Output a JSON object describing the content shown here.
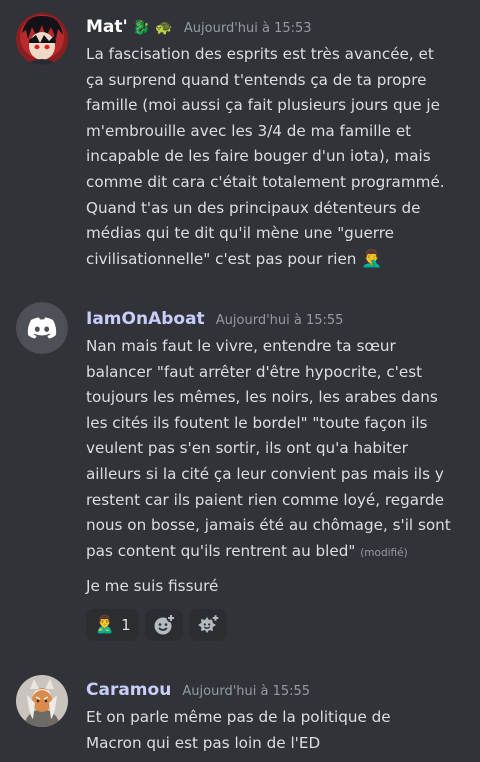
{
  "messages": [
    {
      "author": "Mat'",
      "author_color": "#ffffff",
      "author_emojis": [
        "🐉",
        "🐢"
      ],
      "timestamp": "Aujourd'hui à 15:53",
      "avatar": "anime-character-avatar",
      "lines": [
        "La fascisation des esprits est très avancée, et",
        "ça surprend quand t'entends ça de ta propre",
        "famille (moi aussi ça fait plusieurs jours que je",
        "m'embrouille avec les 3/4 de ma famille et",
        "incapable de les faire bouger d'un iota), mais",
        "comme dit cara c'était totalement programmé.",
        "Quand t'as un des principaux détenteurs de",
        "médias qui te dit qu'il mène une \"guerre",
        "civilisationnelle\" c'est pas pour rien"
      ],
      "trailing_emoji": "🤦‍♂️"
    },
    {
      "author": "IamOnAboat",
      "author_color": "#c9cdfb",
      "timestamp": "Aujourd'hui à 15:55",
      "avatar": "discord-logo-avatar",
      "lines": [
        "Nan mais faut le vivre, entendre ta sœur",
        "balancer \"faut arrêter d'être hypocrite, c'est",
        "toujours les mêmes, les noirs, les arabes dans",
        "les cités ils foutent le bordel\" \"toute façon ils",
        "veulent pas s'en sortir, ils ont qu'a habiter",
        "ailleurs si la cité ça leur convient pas mais ils y",
        "restent car ils paient rien comme loyé, regarde",
        "nous on bosse, jamais été au chômage, s'il sont",
        "pas content qu'ils rentrent au bled\""
      ],
      "edited": "(modifié)",
      "followup": "Je me suis fissuré",
      "reactions": [
        {
          "emoji": "🙎‍♂️",
          "count": "1"
        }
      ],
      "add_reaction_icons": [
        "add-reaction-icon",
        "add-super-reaction-icon"
      ]
    },
    {
      "author": "Caramou",
      "author_color": "#c9cdfb",
      "timestamp": "Aujourd'hui à 15:55",
      "avatar": "warrior-character-avatar",
      "lines": [
        "Et on parle même pas de la politique de",
        "Macron qui est pas loin de l'ED"
      ]
    }
  ]
}
